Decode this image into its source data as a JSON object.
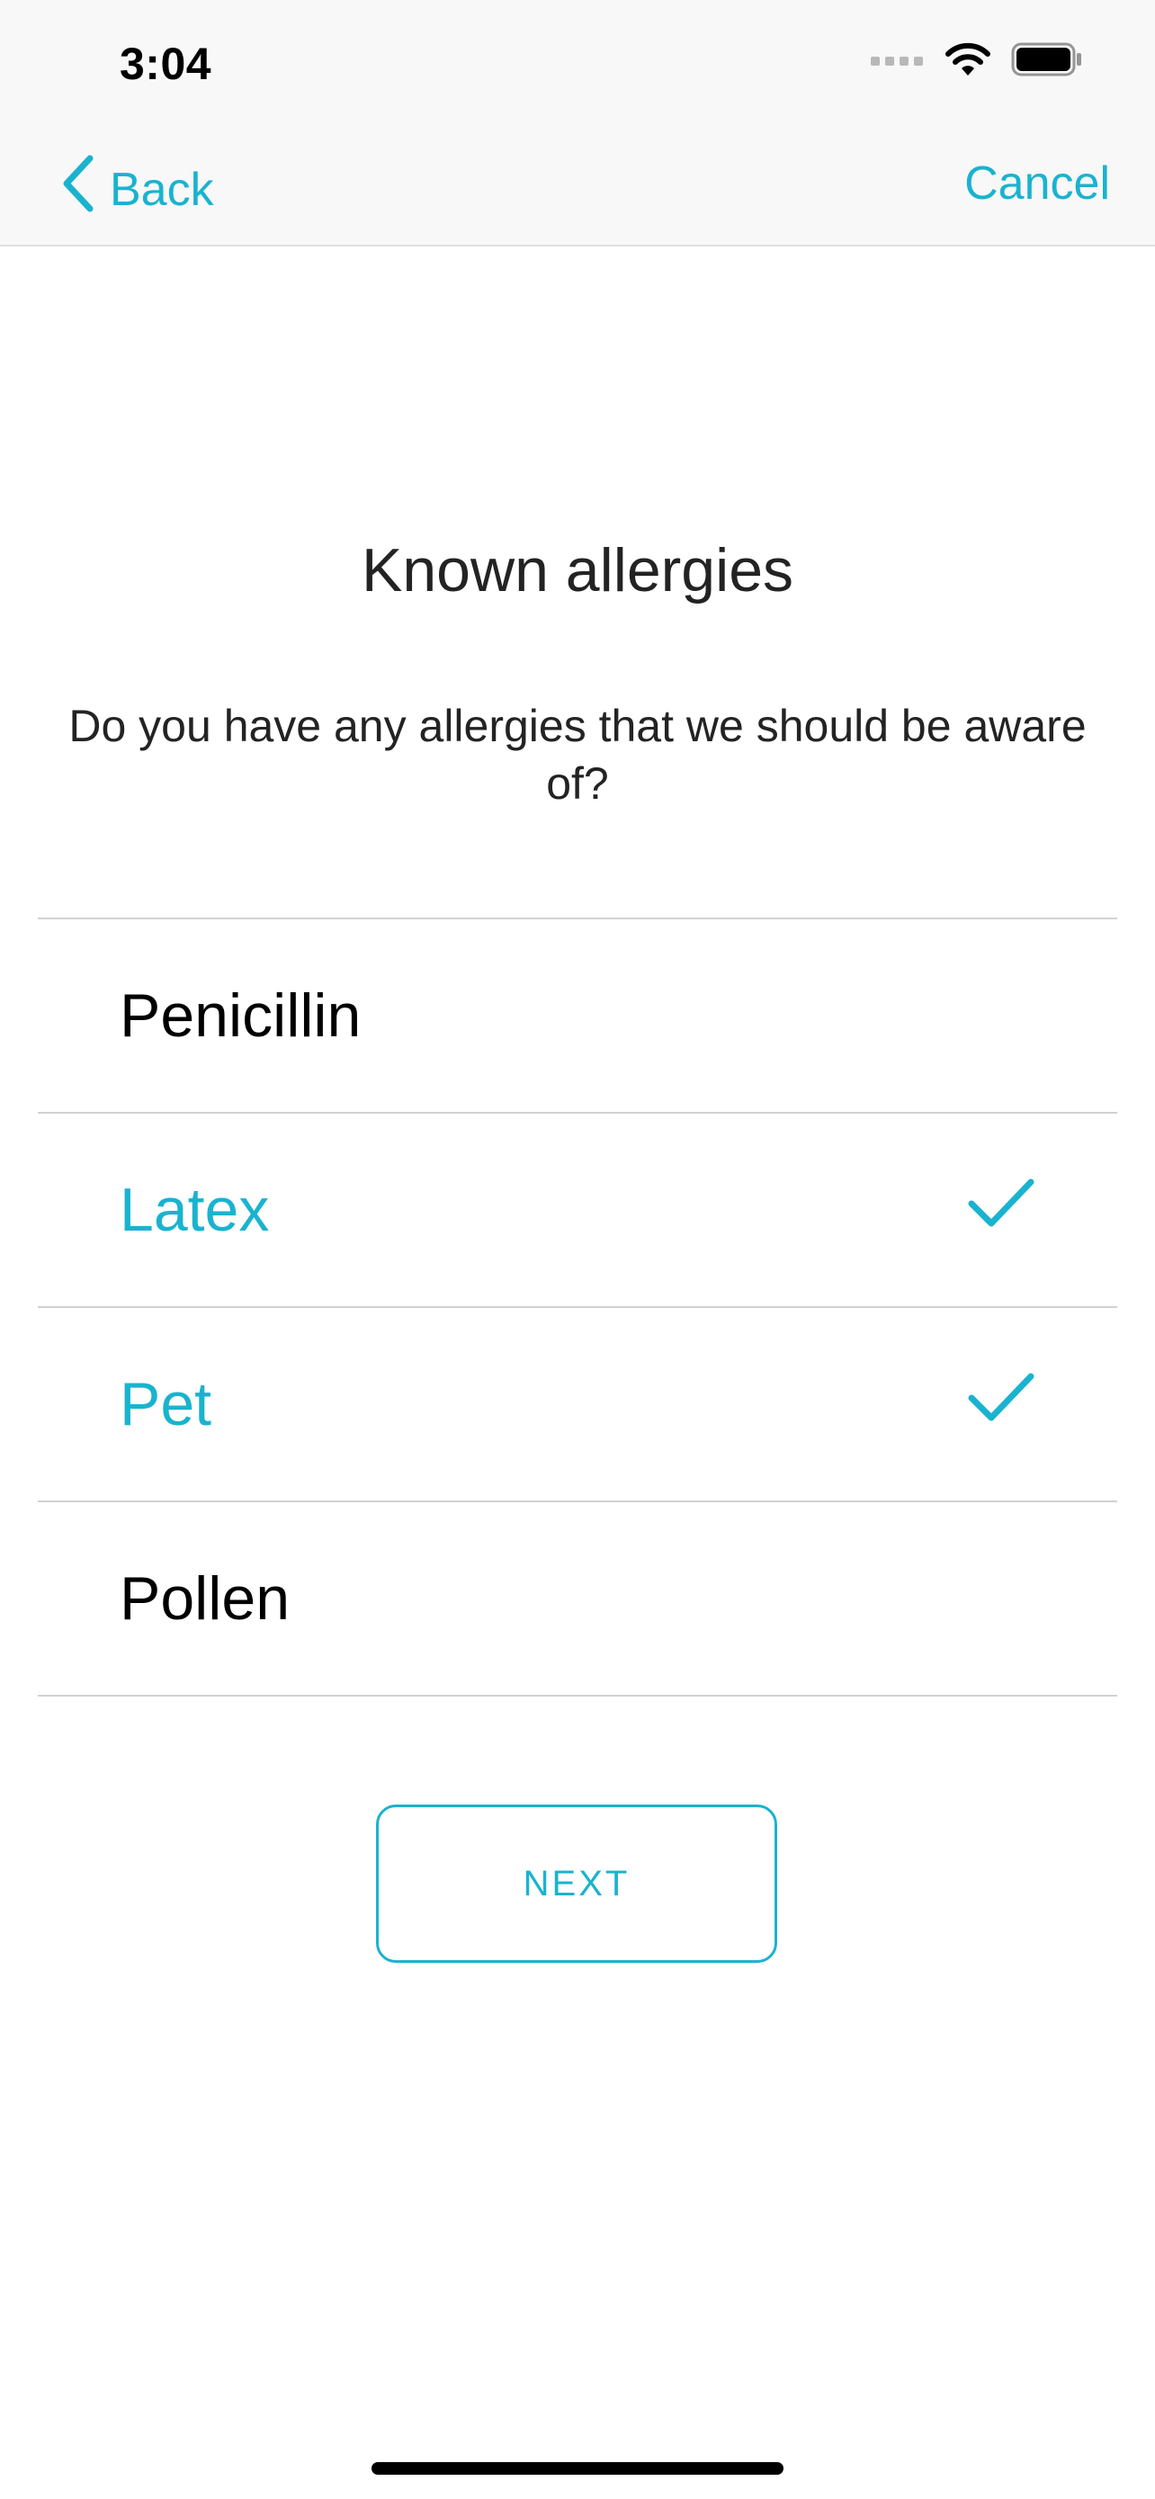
{
  "status_bar": {
    "time": "3:04",
    "icons": [
      "cellular-signal-icon",
      "wifi-icon",
      "battery-icon"
    ]
  },
  "nav": {
    "back_label": "Back",
    "cancel_label": "Cancel"
  },
  "page": {
    "title": "Known allergies",
    "subtitle": "Do you have any allergies that we should be aware of?"
  },
  "allergies": [
    {
      "label": "Penicillin",
      "selected": false
    },
    {
      "label": "Latex",
      "selected": true
    },
    {
      "label": "Pet",
      "selected": true
    },
    {
      "label": "Pollen",
      "selected": false
    }
  ],
  "next_label": "NEXT",
  "colors": {
    "accent": "#1ab3cf",
    "text": "#232323",
    "divider": "#d2d2d2",
    "nav_background": "#f8f8f8"
  }
}
